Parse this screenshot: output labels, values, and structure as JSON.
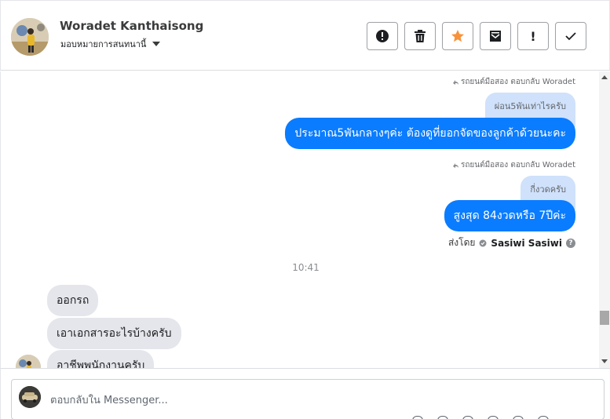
{
  "header": {
    "contact_name": "Woradet Kanthaisong",
    "assign_label": "มอบหมายการสนทนานี้",
    "toolbar": [
      {
        "name": "report-spam-button",
        "icon": "alert-circle-icon"
      },
      {
        "name": "delete-button",
        "icon": "trash-icon"
      },
      {
        "name": "star-button",
        "icon": "star-icon"
      },
      {
        "name": "mark-unread-button",
        "icon": "envelope-icon"
      },
      {
        "name": "follow-up-button",
        "icon": "exclamation-icon",
        "text": "!"
      },
      {
        "name": "mark-done-button",
        "icon": "check-icon"
      }
    ],
    "star_color": "#f7923b"
  },
  "conversation": {
    "messages": [
      {
        "reply_note": "รถยนต์มือสอง ตอบกลับ Woradet",
        "quoted": "ผ่อน5พันเท่าไรครับ",
        "text": "ประมาณ5พันกลางๆค่ะ ต้องดูที่ยอกจัดของลูกค้าด้วยนะคะ"
      },
      {
        "reply_note": "รถยนต์มือสอง ตอบกลับ Woradet",
        "quoted": "กี่งวดครับ",
        "text": "สูงสุด 84งวดหรือ 7ปีค่ะ"
      }
    ],
    "sent_by_label": "ส่งโดย",
    "sender_name": "Sasiwi Sasiwi",
    "time_separator": "10:41",
    "incoming": [
      {
        "text": "ออกรถ"
      },
      {
        "text": "เอาเอกสารอะไรบ้างครับ"
      },
      {
        "text": "อาชีพพนักงานครับ"
      }
    ],
    "outgoing_color": "#0a7cff",
    "quoted_color": "#cfe1fb"
  },
  "composer": {
    "placeholder": "ตอบกลับใน Messenger..."
  }
}
